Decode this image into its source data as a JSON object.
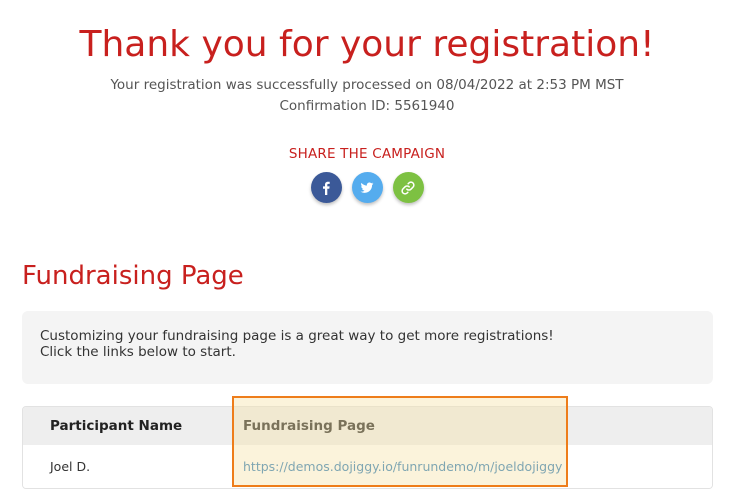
{
  "header": {
    "title": "Thank you for your registration!",
    "processed_text": "Your registration was successfully processed on 08/04/2022 at 2:53 PM MST",
    "confirmation_text": "Confirmation ID: 5561940"
  },
  "share": {
    "label": "SHARE THE CAMPAIGN",
    "buttons": [
      {
        "name": "facebook",
        "icon": "facebook-icon",
        "color": "#3b5998"
      },
      {
        "name": "twitter",
        "icon": "twitter-icon",
        "color": "#55acee"
      },
      {
        "name": "copy-link",
        "icon": "link-icon",
        "color": "#7dc142"
      }
    ]
  },
  "fundraising": {
    "title": "Fundraising Page",
    "info_line1": "Customizing your fundraising page is a great way to get more registrations!",
    "info_line2": "Click the links below to start.",
    "table": {
      "headers": [
        "Participant Name",
        "Fundraising Page"
      ],
      "rows": [
        {
          "name": "Joel D.",
          "url": "https://demos.dojiggy.io/funrundemo/m/joeldojiggy"
        }
      ]
    }
  },
  "colors": {
    "accent_red": "#c8201e",
    "link_blue": "#2a7ab8",
    "highlight_orange": "#ee7d1a"
  }
}
